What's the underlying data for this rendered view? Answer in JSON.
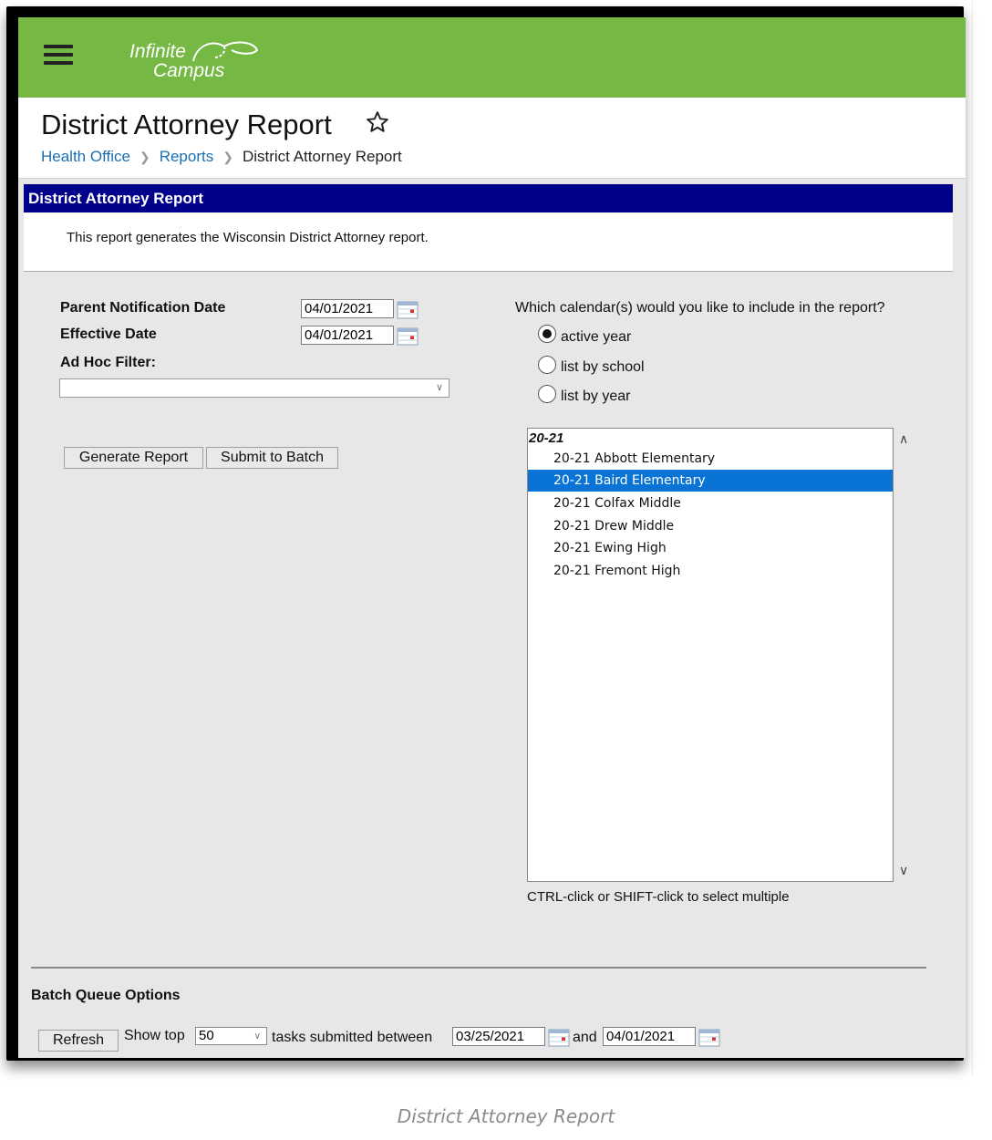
{
  "logo": {
    "line1": "Infinite",
    "line2": "Campus"
  },
  "header": {
    "title": "District Attorney Report",
    "breadcrumb": {
      "item1": "Health Office",
      "item2": "Reports",
      "current": "District Attorney Report"
    }
  },
  "panel": {
    "heading": "District Attorney Report",
    "description": "This report generates the Wisconsin District Attorney report."
  },
  "form": {
    "parent_notification_label": "Parent Notification Date",
    "parent_notification_value": "04/01/2021",
    "effective_date_label": "Effective Date",
    "effective_date_value": "04/01/2021",
    "adhoc_label": "Ad Hoc Filter:",
    "adhoc_value": "",
    "generate_label": "Generate Report",
    "submit_label": "Submit to Batch"
  },
  "calendar": {
    "question": "Which calendar(s) would you like to include in the report?",
    "options": [
      "active year",
      "list by school",
      "list by year"
    ],
    "selected_option": "active year",
    "group": "20-21",
    "items": [
      "20-21 Abbott Elementary",
      "20-21 Baird Elementary",
      "20-21 Colfax Middle",
      "20-21 Drew Middle",
      "20-21 Ewing High",
      "20-21 Fremont High"
    ],
    "selected_item": "20-21 Baird Elementary",
    "hint": "CTRL-click or SHIFT-click to select multiple"
  },
  "batch": {
    "heading": "Batch Queue Options",
    "refresh_label": "Refresh",
    "show_top_label": "Show top",
    "show_top_value": "50",
    "between_label": "tasks submitted between",
    "start_date": "03/25/2021",
    "and_label": "and",
    "end_date": "04/01/2021"
  },
  "caption": "District Attorney Report",
  "colors": {
    "topbar": "#75b843",
    "panel_heading": "#00008b",
    "link": "#1a6fb0",
    "selection": "#0a74d6"
  },
  "icons": [
    "menu-icon",
    "star-icon",
    "calendar-icon",
    "chevron-down-icon",
    "scroll-up-icon",
    "scroll-down-icon"
  ]
}
